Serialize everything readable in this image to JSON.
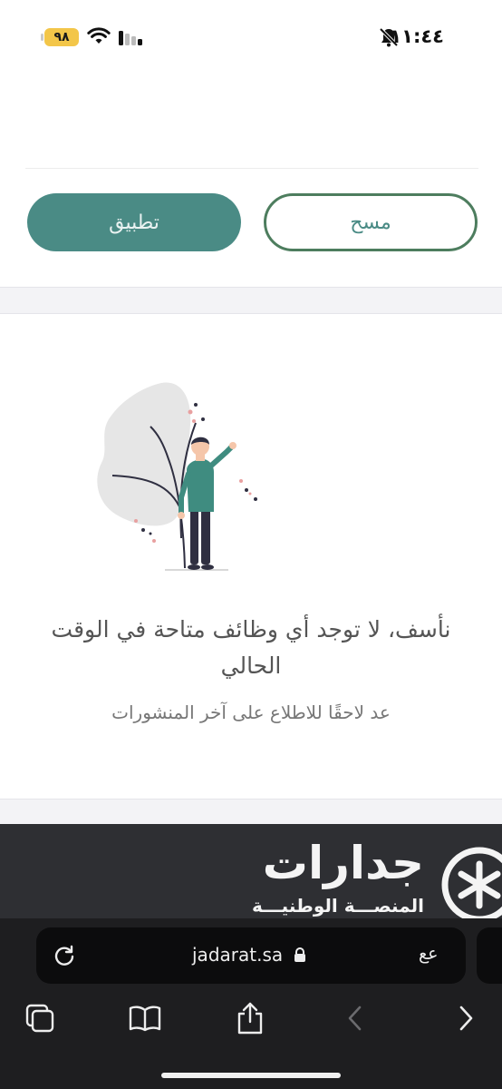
{
  "status_bar": {
    "time": "١١:٤٤",
    "battery": "٩٨",
    "icons": [
      "bell-slash-icon",
      "signal-icon",
      "wifi-icon"
    ]
  },
  "filters": {
    "apply_label": "تطبيق",
    "clear_label": "مسح"
  },
  "empty_state": {
    "title": "نأسف، لا توجد أي وظائف متاحة في الوقت الحالي",
    "subtitle": "عد لاحقًا للاطلاع على آخر المنشورات"
  },
  "footer": {
    "brand_name": "جدارات",
    "brand_subtitle": "المنصـــة الوطنيـــة"
  },
  "browser": {
    "url": "jadarat.sa",
    "text_size_label": "عع",
    "toolbar_icons": [
      "tabs-icon",
      "bookmarks-icon",
      "share-icon",
      "back-icon",
      "forward-icon"
    ]
  },
  "colors": {
    "brand_teal": "#4a8b85",
    "clear_border": "#4d7d5e",
    "footer_bg": "#2e2f33",
    "battery": "#f3c649"
  }
}
